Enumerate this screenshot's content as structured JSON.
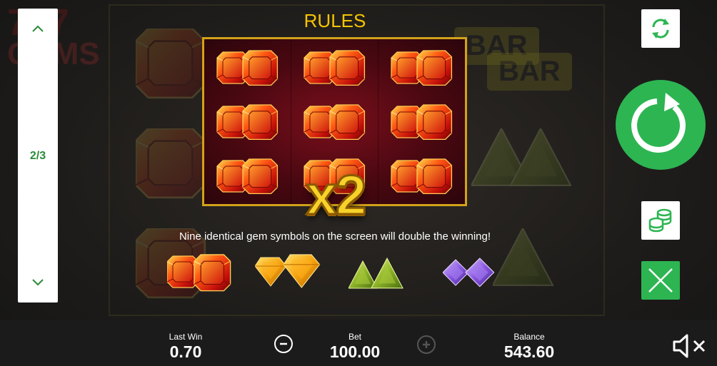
{
  "rules": {
    "title": "RULES",
    "multiplier": "x2",
    "description": "Nine identical gem symbols on the screen will double the winning!"
  },
  "pager": {
    "page_indicator": "2/3",
    "up_icon": "chevron-up-icon",
    "down_icon": "chevron-down-icon"
  },
  "panel": {
    "symbol": "red-gem",
    "rows": 3,
    "cols": 3
  },
  "gem_row": [
    "red-gem",
    "orange-gem",
    "green-gem",
    "purple-gem"
  ],
  "background": {
    "logo_text": "GEMS",
    "bar_labels": [
      "BAR",
      "BAR"
    ]
  },
  "controls": {
    "autoplay_icon": "refresh-icon",
    "spin_icon": "spin-icon",
    "bet_icon": "coins-icon",
    "close_icon": "close-icon",
    "sound_icon": "sound-muted-icon"
  },
  "bottom": {
    "last_win_label": "Last Win",
    "last_win_value": "0.70",
    "bet_label": "Bet",
    "bet_value": "100.00",
    "balance_label": "Balance",
    "balance_value": "543.60"
  },
  "colors": {
    "accent_green": "#2db552",
    "title_gold": "#f5c400",
    "panel_border": "#d2a21a",
    "page_indicator": "#2a8a3a"
  }
}
